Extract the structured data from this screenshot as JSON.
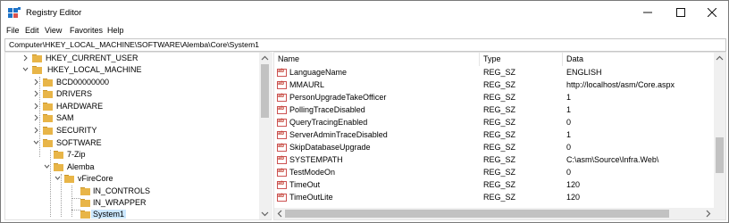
{
  "window": {
    "title": "Registry Editor",
    "controls": {
      "minimize": "minimize",
      "maximize": "maximize",
      "close": "close"
    }
  },
  "menu": [
    "File",
    "Edit",
    "View",
    "Favorites",
    "Help"
  ],
  "address": "Computer\\HKEY_LOCAL_MACHINE\\SOFTWARE\\Alemba\\Core\\System1",
  "tree": [
    {
      "label": "HKEY_CURRENT_USER",
      "depth": 1,
      "expander": "collapsed"
    },
    {
      "label": "HKEY_LOCAL_MACHINE",
      "depth": 1,
      "expander": "expanded"
    },
    {
      "label": "BCD00000000",
      "depth": 2,
      "expander": "collapsed"
    },
    {
      "label": "DRIVERS",
      "depth": 2,
      "expander": "collapsed"
    },
    {
      "label": "HARDWARE",
      "depth": 2,
      "expander": "collapsed"
    },
    {
      "label": "SAM",
      "depth": 2,
      "expander": "collapsed"
    },
    {
      "label": "SECURITY",
      "depth": 2,
      "expander": "collapsed"
    },
    {
      "label": "SOFTWARE",
      "depth": 2,
      "expander": "expanded"
    },
    {
      "label": "7-Zip",
      "depth": 3,
      "expander": "none"
    },
    {
      "label": "Alemba",
      "depth": 3,
      "expander": "expanded"
    },
    {
      "label": "vFireCore",
      "depth": 4,
      "expander": "expanded"
    },
    {
      "label": "IN_CONTROLS",
      "depth": 5,
      "expander": "none"
    },
    {
      "label": "IN_WRAPPER",
      "depth": 5,
      "expander": "none"
    },
    {
      "label": "System1",
      "depth": 5,
      "expander": "none",
      "selected": true
    }
  ],
  "columns": {
    "name": "Name",
    "type": "Type",
    "data": "Data"
  },
  "values": [
    {
      "name": "LanguageName",
      "type": "REG_SZ",
      "data": "ENGLISH"
    },
    {
      "name": "MMAURL",
      "type": "REG_SZ",
      "data": "http://localhost/asm/Core.aspx"
    },
    {
      "name": "PersonUpgradeTakeOfficer",
      "type": "REG_SZ",
      "data": "1"
    },
    {
      "name": "PollingTraceDisabled",
      "type": "REG_SZ",
      "data": "1",
      "highlight": true
    },
    {
      "name": "QueryTracingEnabled",
      "type": "REG_SZ",
      "data": "0"
    },
    {
      "name": "ServerAdminTraceDisabled",
      "type": "REG_SZ",
      "data": "1",
      "highlight": true
    },
    {
      "name": "SkipDatabaseUpgrade",
      "type": "REG_SZ",
      "data": "0"
    },
    {
      "name": "SYSTEMPATH",
      "type": "REG_SZ",
      "data": "C:\\asm\\Source\\Infra.Web\\"
    },
    {
      "name": "TestModeOn",
      "type": "REG_SZ",
      "data": "0"
    },
    {
      "name": "TimeOut",
      "type": "REG_SZ",
      "data": "120"
    },
    {
      "name": "TimeOutLite",
      "type": "REG_SZ",
      "data": "120"
    }
  ],
  "icons": {
    "app": "registry-editor-icon",
    "folder": "folder-icon",
    "string_value": "string-value-icon"
  },
  "colors": {
    "folder": "#e8b548",
    "folder_dark": "#c9952a",
    "selection": "#cce8ff",
    "pane_bg": "#f2f2f2"
  }
}
